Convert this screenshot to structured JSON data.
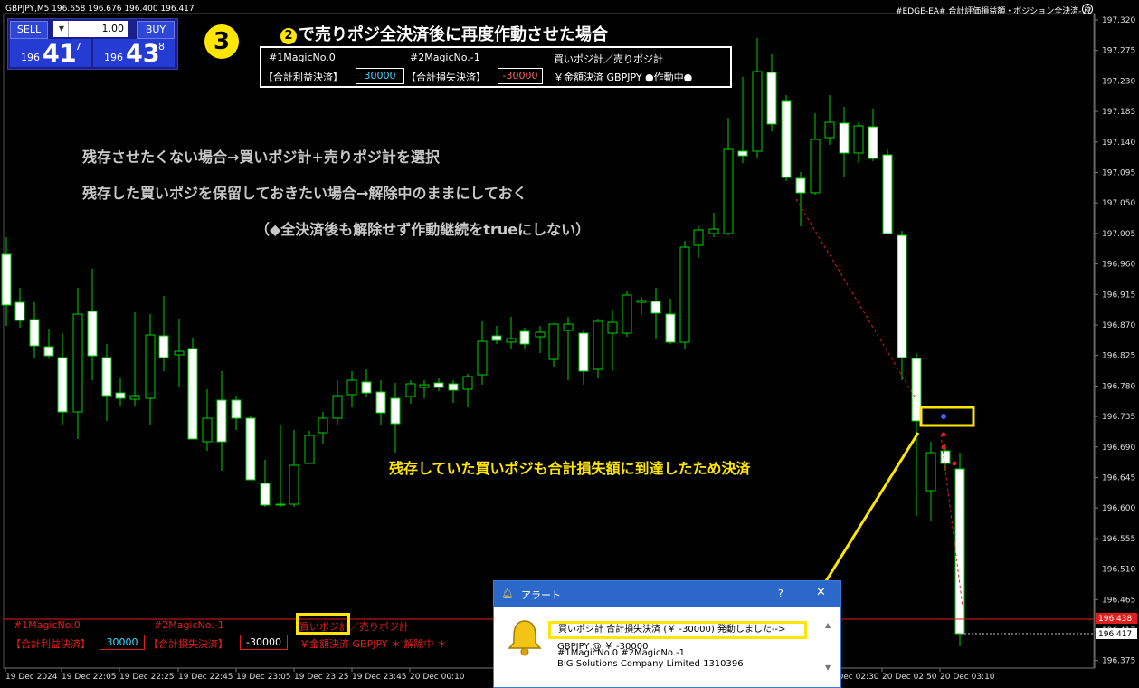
{
  "window": {
    "symbol_line": "GBPJPY,M5  196.658 196.676 196.400 196.417",
    "ea_title": "#EDGE-EA# 合計評価損益額・ポジション全決済-v7"
  },
  "trade_panel": {
    "sell_label": "SELL",
    "buy_label": "BUY",
    "lot": "1.00",
    "sell_prefix": "196",
    "sell_big": "41",
    "sell_sup": "7",
    "buy_prefix": "196",
    "buy_big": "43",
    "buy_sup": "8"
  },
  "step_marker": "3",
  "headline": {
    "num": "2",
    "text": "で売りポジ全決済後に再度作動させた場合"
  },
  "top_panel": {
    "magic1": "#1MagicNo.0",
    "magic2": "#2MagicNo.-1",
    "pos_select": "買いポジ計／売りポジ計",
    "profit_label": "【合計利益決済】",
    "profit_value": "30000",
    "loss_label": "【合計損失決済】",
    "loss_value": "-30000",
    "mode": "￥金額決済 GBPJPY ●作動中●"
  },
  "notes": {
    "line1": "残存させたくない場合→買いポジ計+売りポジ計を選択",
    "line2": "残存した買いポジを保留しておきたい場合→解除中のままにしておく",
    "line3": "（◆全決済後も解除せず作動継続をtrueにしない）",
    "yellow": "残存していた買いポジも合計損失額に到達したため決済"
  },
  "bottom_panel": {
    "magic1": "#1MagicNo.0",
    "magic2": "#2MagicNo.-1",
    "pos_buy": "買いポジ計",
    "pos_rest": "／売りポジ計",
    "profit_label": "【合計利益決済】",
    "profit_value": "30000",
    "loss_label": "【合計損失決済】",
    "loss_value": "-30000",
    "mode": "￥金額決済 GBPJPY ＊ 解除中 ＊"
  },
  "alert": {
    "title": "アラート",
    "help": "?",
    "close": "✕",
    "message": "買いポジ計 合計損失決済 (￥ -30000) 発動しました-->",
    "line1": "GBPJPY @ ￥ -30000",
    "line2": "#1MagicNo.0  #2MagicNo.-1",
    "line3": "BIG Solutions Company Limited   1310396"
  },
  "price_axis": {
    "ticks": [
      "197.320",
      "197.275",
      "197.230",
      "197.185",
      "197.140",
      "197.095",
      "197.050",
      "197.005",
      "196.960",
      "196.915",
      "196.870",
      "196.825",
      "196.780",
      "196.735",
      "196.690",
      "196.645",
      "196.600",
      "196.555",
      "196.510",
      "196.465",
      "196.417",
      "196.375"
    ],
    "red_label": "196.438",
    "current_label": "196.417"
  },
  "time_axis": {
    "labels": [
      "19 Dec 2024",
      "19 Dec 22:05",
      "19 Dec 22:25",
      "19 Dec 22:45",
      "19 Dec 23:05",
      "19 Dec 23:25",
      "19 Dec 23:45",
      "20 Dec 00:10",
      "20 Dec 02:30",
      "20 Dec 02:50",
      "20 Dec 03:10"
    ]
  },
  "colors": {
    "bull_outline": "#00d000",
    "bear_fill": "#ffffff",
    "accent_yellow": "#ffe600",
    "alert_red": "#e01e1e"
  }
}
